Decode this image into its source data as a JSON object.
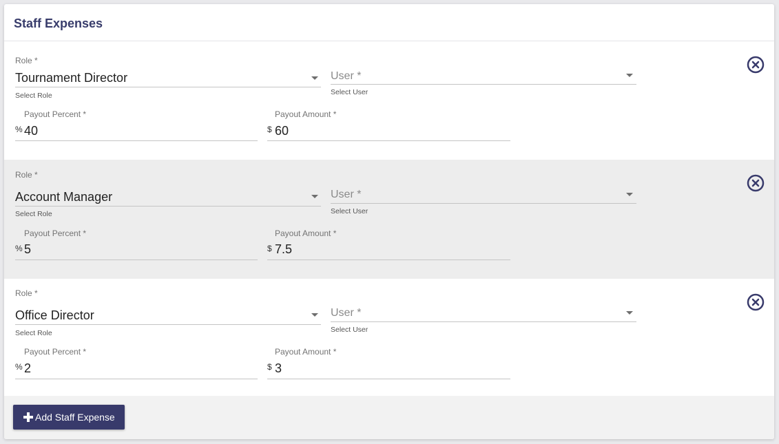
{
  "header": {
    "title": "Staff Expenses"
  },
  "expenses": [
    {
      "role_label": "Role *",
      "role_value": "Tournament Director",
      "role_hint": "Select Role",
      "user_placeholder": "User *",
      "user_hint": "Select User",
      "percent_label": "Payout Percent *",
      "percent_prefix": "%",
      "percent_value": "40",
      "amount_label": "Payout Amount *",
      "amount_prefix": "$",
      "amount_value": "60"
    },
    {
      "role_label": "Role *",
      "role_value": "Account Manager",
      "role_hint": "Select Role",
      "user_placeholder": "User *",
      "user_hint": "Select User",
      "percent_label": "Payout Percent *",
      "percent_prefix": "%",
      "percent_value": "5",
      "amount_label": "Payout Amount *",
      "amount_prefix": "$",
      "amount_value": "7.5"
    },
    {
      "role_label": "Role *",
      "role_value": "Office Director",
      "role_hint": "Select Role",
      "user_placeholder": "User *",
      "user_hint": "Select User",
      "percent_label": "Payout Percent *",
      "percent_prefix": "%",
      "percent_value": "2",
      "amount_label": "Payout Amount *",
      "amount_prefix": "$",
      "amount_value": "3"
    }
  ],
  "actions": {
    "add_label": "Add Staff Expense"
  },
  "colors": {
    "accent": "#383a6b",
    "title": "#383c6b",
    "row_alt": "#ededed"
  },
  "icons": {
    "remove": "close-circle-icon",
    "dropdown": "caret-down-icon",
    "add": "plus-icon"
  }
}
